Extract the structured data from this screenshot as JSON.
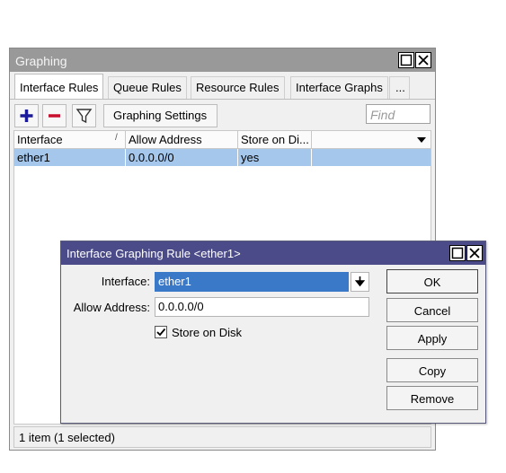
{
  "window": {
    "title": "Graphing",
    "tabs": [
      "Interface Rules",
      "Queue Rules",
      "Resource Rules",
      "Interface Graphs",
      "..."
    ],
    "toolbar": {
      "add_icon": "plus-icon",
      "remove_icon": "minus-icon",
      "filter_icon": "filter-icon",
      "settings_label": "Graphing Settings",
      "find_placeholder": "Find"
    },
    "table": {
      "columns": [
        "Interface",
        "Allow Address",
        "Store on Di...",
        ""
      ],
      "sort_mark": "/",
      "rows": [
        {
          "interface": "ether1",
          "allow_address": "0.0.0.0/0",
          "store_on_disk": "yes",
          "selected": true
        }
      ]
    },
    "status": "1 item (1 selected)"
  },
  "dialog": {
    "title": "Interface Graphing Rule <ether1>",
    "interface_label": "Interface:",
    "interface_value": "ether1",
    "allow_label": "Allow Address:",
    "allow_value": "0.0.0.0/0",
    "store_label": "Store on Disk",
    "store_checked": true,
    "buttons": {
      "ok": "OK",
      "cancel": "Cancel",
      "apply": "Apply",
      "copy": "Copy",
      "remove": "Remove"
    }
  },
  "colors": {
    "selection": "#a5c7ec",
    "dialog_titlebar": "#4b4b8a",
    "window_titlebar": "#999999",
    "add_icon": "#1a1a9a",
    "remove_icon": "#c8102e"
  }
}
